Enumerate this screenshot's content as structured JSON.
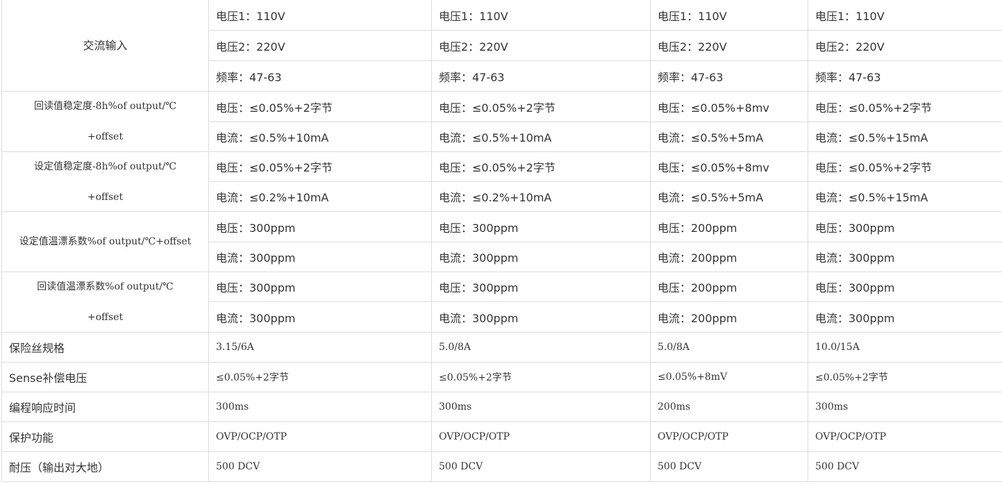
{
  "rows": {
    "ac_input": {
      "label": "交流输入",
      "v1": [
        "电压1：110V",
        "电压1：110V",
        "电压1：110V",
        "电压1：110V"
      ],
      "v2": [
        "电压2：220V",
        "电压2：220V",
        "电压2：220V",
        "电压2：220V"
      ],
      "freq": [
        "频率：47-63",
        "频率：47-63",
        "频率：47-63",
        "频率：47-63"
      ]
    },
    "readback_stability": {
      "label_line1": "回读值稳定度-8h%of output/℃",
      "label_line2": "+offset",
      "voltage": [
        "电压：≤0.05%+2字节",
        "电压：≤0.05%+2字节",
        "电压：≤0.05%+8mv",
        "电压：≤0.05%+2字节"
      ],
      "current": [
        "电流：≤0.5%+10mA",
        "电流：≤0.5%+10mA",
        "电流：≤0.5%+5mA",
        "电流：≤0.5%+15mA"
      ]
    },
    "setpoint_stability": {
      "label_line1": "设定值稳定度-8h%of output/℃",
      "label_line2": "+offset",
      "voltage": [
        "电压：≤0.05%+2字节",
        "电压：≤0.05%+2字节",
        "电压：≤0.05%+8mv",
        "电压：≤0.05%+2字节"
      ],
      "current": [
        "电流：≤0.2%+10mA",
        "电流：≤0.2%+10mA",
        "电流：≤0.5%+5mA",
        "电流：≤0.5%+15mA"
      ]
    },
    "setpoint_tempco": {
      "label": "设定值温漂系数%of output/℃+offset",
      "voltage": [
        "电压：300ppm",
        "电压：300ppm",
        "电压：200ppm",
        "电压：300ppm"
      ],
      "current": [
        "电流：300ppm",
        "电流：300ppm",
        "电流：200ppm",
        "电流：300ppm"
      ]
    },
    "readback_tempco": {
      "label_line1": "回读值温漂系数%of output/℃",
      "label_line2": "+offset",
      "voltage": [
        "电压：300ppm",
        "电压：300ppm",
        "电压：200ppm",
        "电压：300ppm"
      ],
      "current": [
        "电流：300ppm",
        "电流：300ppm",
        "电流：200ppm",
        "电流：300ppm"
      ]
    },
    "fuse_spec": {
      "label": "保险丝规格",
      "values": [
        "3.15/6A",
        "5.0/8A",
        "5.0/8A",
        "10.0/15A"
      ]
    },
    "sense_comp": {
      "label": "Sense补偿电压",
      "values": [
        "≤0.05%+2字节",
        "≤0.05%+2字节",
        "≤0.05%+8mV",
        "≤0.05%+2字节"
      ]
    },
    "prog_response": {
      "label": "编程响应时间",
      "values": [
        "300ms",
        "300ms",
        "200ms",
        "300ms"
      ]
    },
    "protection": {
      "label": "保护功能",
      "values": [
        "OVP/OCP/OTP",
        "OVP/OCP/OTP",
        "OVP/OCP/OTP",
        "OVP/OCP/OTP"
      ]
    },
    "withstand": {
      "label": "耐压（输出对大地）",
      "values": [
        "500 DCV",
        "500 DCV",
        "500 DCV",
        "500 DCV"
      ]
    }
  }
}
